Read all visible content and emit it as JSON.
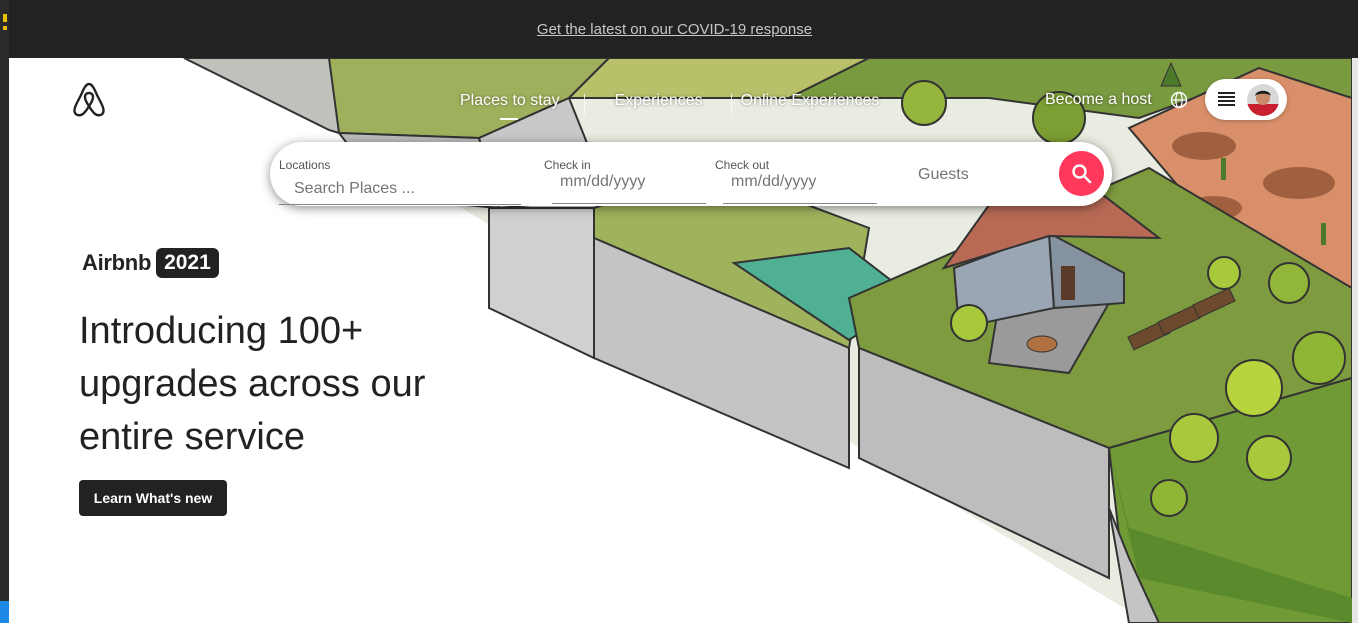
{
  "announcement": {
    "link_text": "Get the latest on our COVID-19 response"
  },
  "header": {
    "tabs": [
      {
        "label": "Places to stay",
        "active": true
      },
      {
        "label": "Experiences",
        "active": false
      },
      {
        "label": "Online Experiences",
        "active": false
      }
    ],
    "host_link": "Become a host",
    "icons": {
      "logo": "airbnb-logo-icon",
      "language": "globe-icon",
      "menu": "menu-icon",
      "avatar": "user-avatar"
    }
  },
  "search": {
    "location": {
      "label": "Locations",
      "placeholder": "Search Places ..."
    },
    "check_in": {
      "label": "Check in",
      "placeholder": "mm/dd/yyyy"
    },
    "check_out": {
      "label": "Check out",
      "placeholder": "mm/dd/yyyy"
    },
    "guests": "Guests",
    "button_icon": "search-icon"
  },
  "hero": {
    "brand_name": "Airbnb",
    "brand_year": "2021",
    "headline": "Introducing 100+ upgrades across our entire service",
    "cta": "Learn What's new"
  },
  "colors": {
    "brand": "#ff385c",
    "dark": "#222222",
    "top_bar": "#222222"
  }
}
